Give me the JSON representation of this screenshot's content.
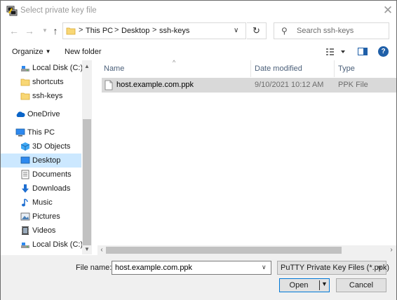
{
  "window": {
    "title": "Select private key file",
    "close_glyph": "✕"
  },
  "address_bar": {
    "breadcrumbs": [
      "This PC",
      "Desktop",
      "ssh-keys"
    ],
    "separator": ">"
  },
  "search": {
    "placeholder": "Search ssh-keys"
  },
  "toolbar": {
    "organize_label": "Organize",
    "new_folder_label": "New folder",
    "help_glyph": "?"
  },
  "nav_pane": {
    "items": [
      {
        "label": "Local Disk (C:)",
        "icon": "drive-icon"
      },
      {
        "label": "shortcuts",
        "icon": "folder-icon"
      },
      {
        "label": "ssh-keys",
        "icon": "folder-icon"
      },
      {
        "label": "OneDrive",
        "icon": "cloud-icon"
      },
      {
        "label": "This PC",
        "icon": "computer-icon"
      },
      {
        "label": "3D Objects",
        "icon": "cube-icon"
      },
      {
        "label": "Desktop",
        "icon": "desktop-icon",
        "selected": true
      },
      {
        "label": "Documents",
        "icon": "documents-icon"
      },
      {
        "label": "Downloads",
        "icon": "download-icon"
      },
      {
        "label": "Music",
        "icon": "music-icon"
      },
      {
        "label": "Pictures",
        "icon": "pictures-icon"
      },
      {
        "label": "Videos",
        "icon": "videos-icon"
      },
      {
        "label": "Local Disk (C:)",
        "icon": "drive-icon"
      }
    ]
  },
  "file_list": {
    "columns": [
      "Name",
      "Date modified",
      "Type"
    ],
    "rows": [
      {
        "name": "host.example.com.ppk",
        "date": "9/10/2021 10:12 AM",
        "type": "PPK File",
        "selected": true
      }
    ]
  },
  "bottom": {
    "file_name_label": "File name:",
    "file_name_value": "host.example.com.ppk",
    "file_type": "PuTTY Private Key Files (*.ppk)",
    "open_label": "Open",
    "cancel_label": "Cancel"
  },
  "colors": {
    "selection": "#cce8ff",
    "row_selected": "#d9d9d9",
    "accent": "#0078d7"
  }
}
